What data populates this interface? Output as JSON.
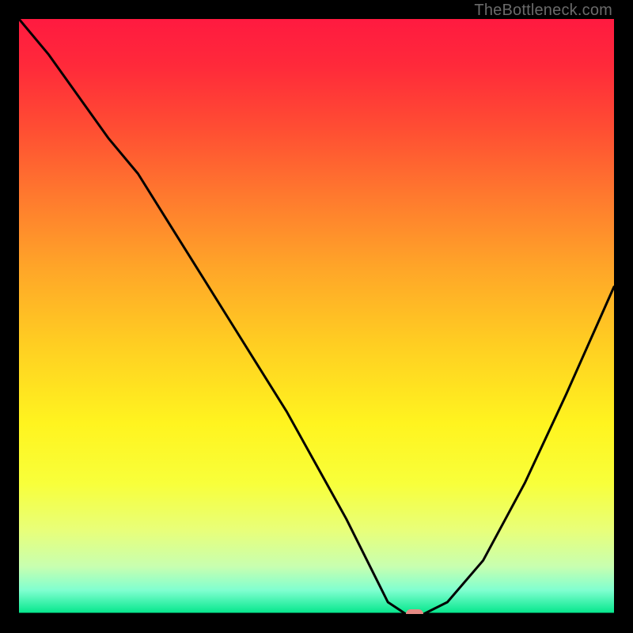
{
  "watermark": "TheBottleneck.com",
  "colors": {
    "curve": "#000000",
    "marker": "#e58a84",
    "gradient_top": "#ff1a40",
    "gradient_bottom": "#00e68a"
  },
  "chart_data": {
    "type": "line",
    "title": "",
    "xlabel": "",
    "ylabel": "",
    "xlim": [
      0,
      100
    ],
    "ylim": [
      0,
      100
    ],
    "axis_y_at": 0,
    "series": [
      {
        "name": "bottleneck-curve",
        "x": [
          0,
          5,
          10,
          15,
          20,
          25,
          30,
          35,
          40,
          45,
          50,
          55,
          60,
          62,
          65,
          68,
          72,
          78,
          85,
          92,
          100
        ],
        "y": [
          100,
          94,
          87,
          80,
          74,
          66,
          58,
          50,
          42,
          34,
          25,
          16,
          6,
          2,
          0,
          0,
          2,
          9,
          22,
          37,
          55
        ]
      }
    ],
    "marker": {
      "x": 66.5,
      "y": 0
    }
  }
}
